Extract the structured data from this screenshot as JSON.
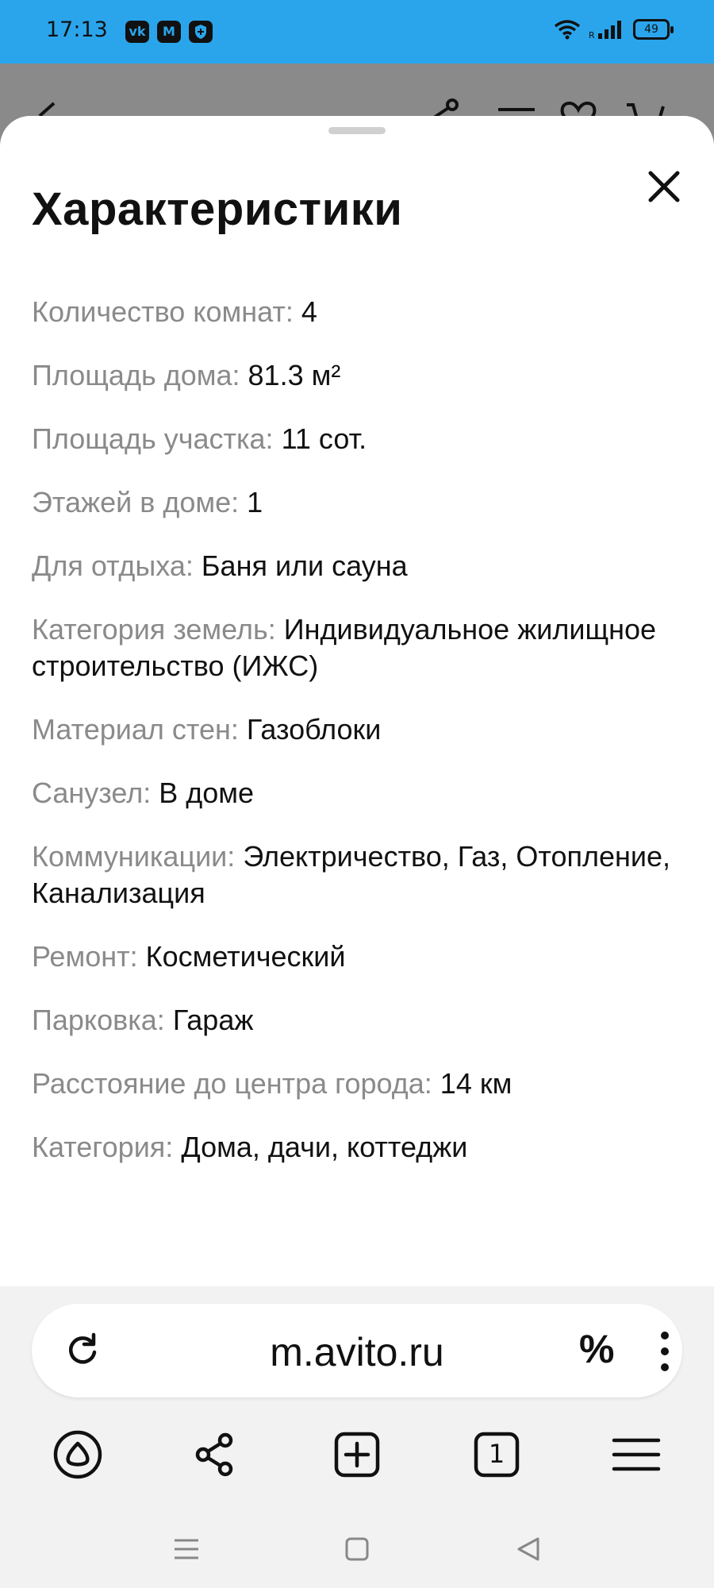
{
  "status_bar": {
    "time": "17:13",
    "app_icons": [
      "vk-icon",
      "mail-icon",
      "shield-icon"
    ],
    "battery": "49"
  },
  "sheet": {
    "title": "Характеристики",
    "properties": [
      {
        "key": "Количество комнат:",
        "value": "4"
      },
      {
        "key": "Площадь дома:",
        "value": "81.3 м²"
      },
      {
        "key": "Площадь участка:",
        "value": "11 сот."
      },
      {
        "key": "Этажей в доме:",
        "value": "1"
      },
      {
        "key": "Для отдыха:",
        "value": "Баня или сауна"
      },
      {
        "key": "Категория земель:",
        "value": "Индивидуальное жилищное строительство (ИЖС)"
      },
      {
        "key": "Материал стен:",
        "value": "Газоблоки"
      },
      {
        "key": "Санузел:",
        "value": "В доме"
      },
      {
        "key": "Коммуникации:",
        "value": "Электричество, Газ, Отопление, Канализация"
      },
      {
        "key": "Ремонт:",
        "value": "Косметический"
      },
      {
        "key": "Парковка:",
        "value": "Гараж"
      },
      {
        "key": "Расстояние до центра города:",
        "value": "14 км"
      },
      {
        "key": "Категория:",
        "value": "Дома, дачи, коттеджи"
      }
    ]
  },
  "browser": {
    "url": "m.avito.ru",
    "percent_label": "%",
    "tab_count": "1"
  },
  "colors": {
    "status_bar": "#2aa5ec",
    "key_text": "#8a8a8a",
    "value_text": "#111111"
  }
}
